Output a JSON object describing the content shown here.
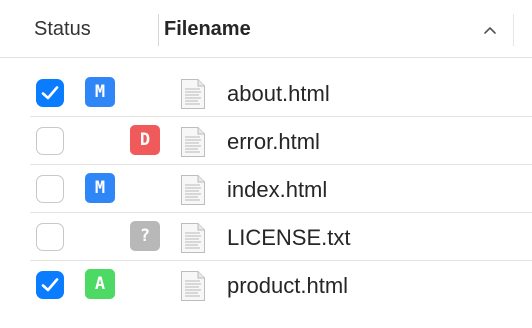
{
  "header": {
    "status_label": "Status",
    "filename_label": "Filename",
    "sort_icon": "chevron-up-icon"
  },
  "colors": {
    "checkbox_checked": "#0a7cff",
    "badge_M": "#2f86f6",
    "badge_D": "#f05a5a",
    "badge_A": "#4cd964",
    "badge_?": "#b8b8b8"
  },
  "files": [
    {
      "checked": true,
      "status": "M",
      "staged": true,
      "name": "about.html"
    },
    {
      "checked": false,
      "status": "D",
      "staged": false,
      "name": "error.html"
    },
    {
      "checked": false,
      "status": "M",
      "staged": true,
      "name": "index.html"
    },
    {
      "checked": false,
      "status": "?",
      "staged": false,
      "name": "LICENSE.txt"
    },
    {
      "checked": true,
      "status": "A",
      "staged": true,
      "name": "product.html"
    }
  ]
}
